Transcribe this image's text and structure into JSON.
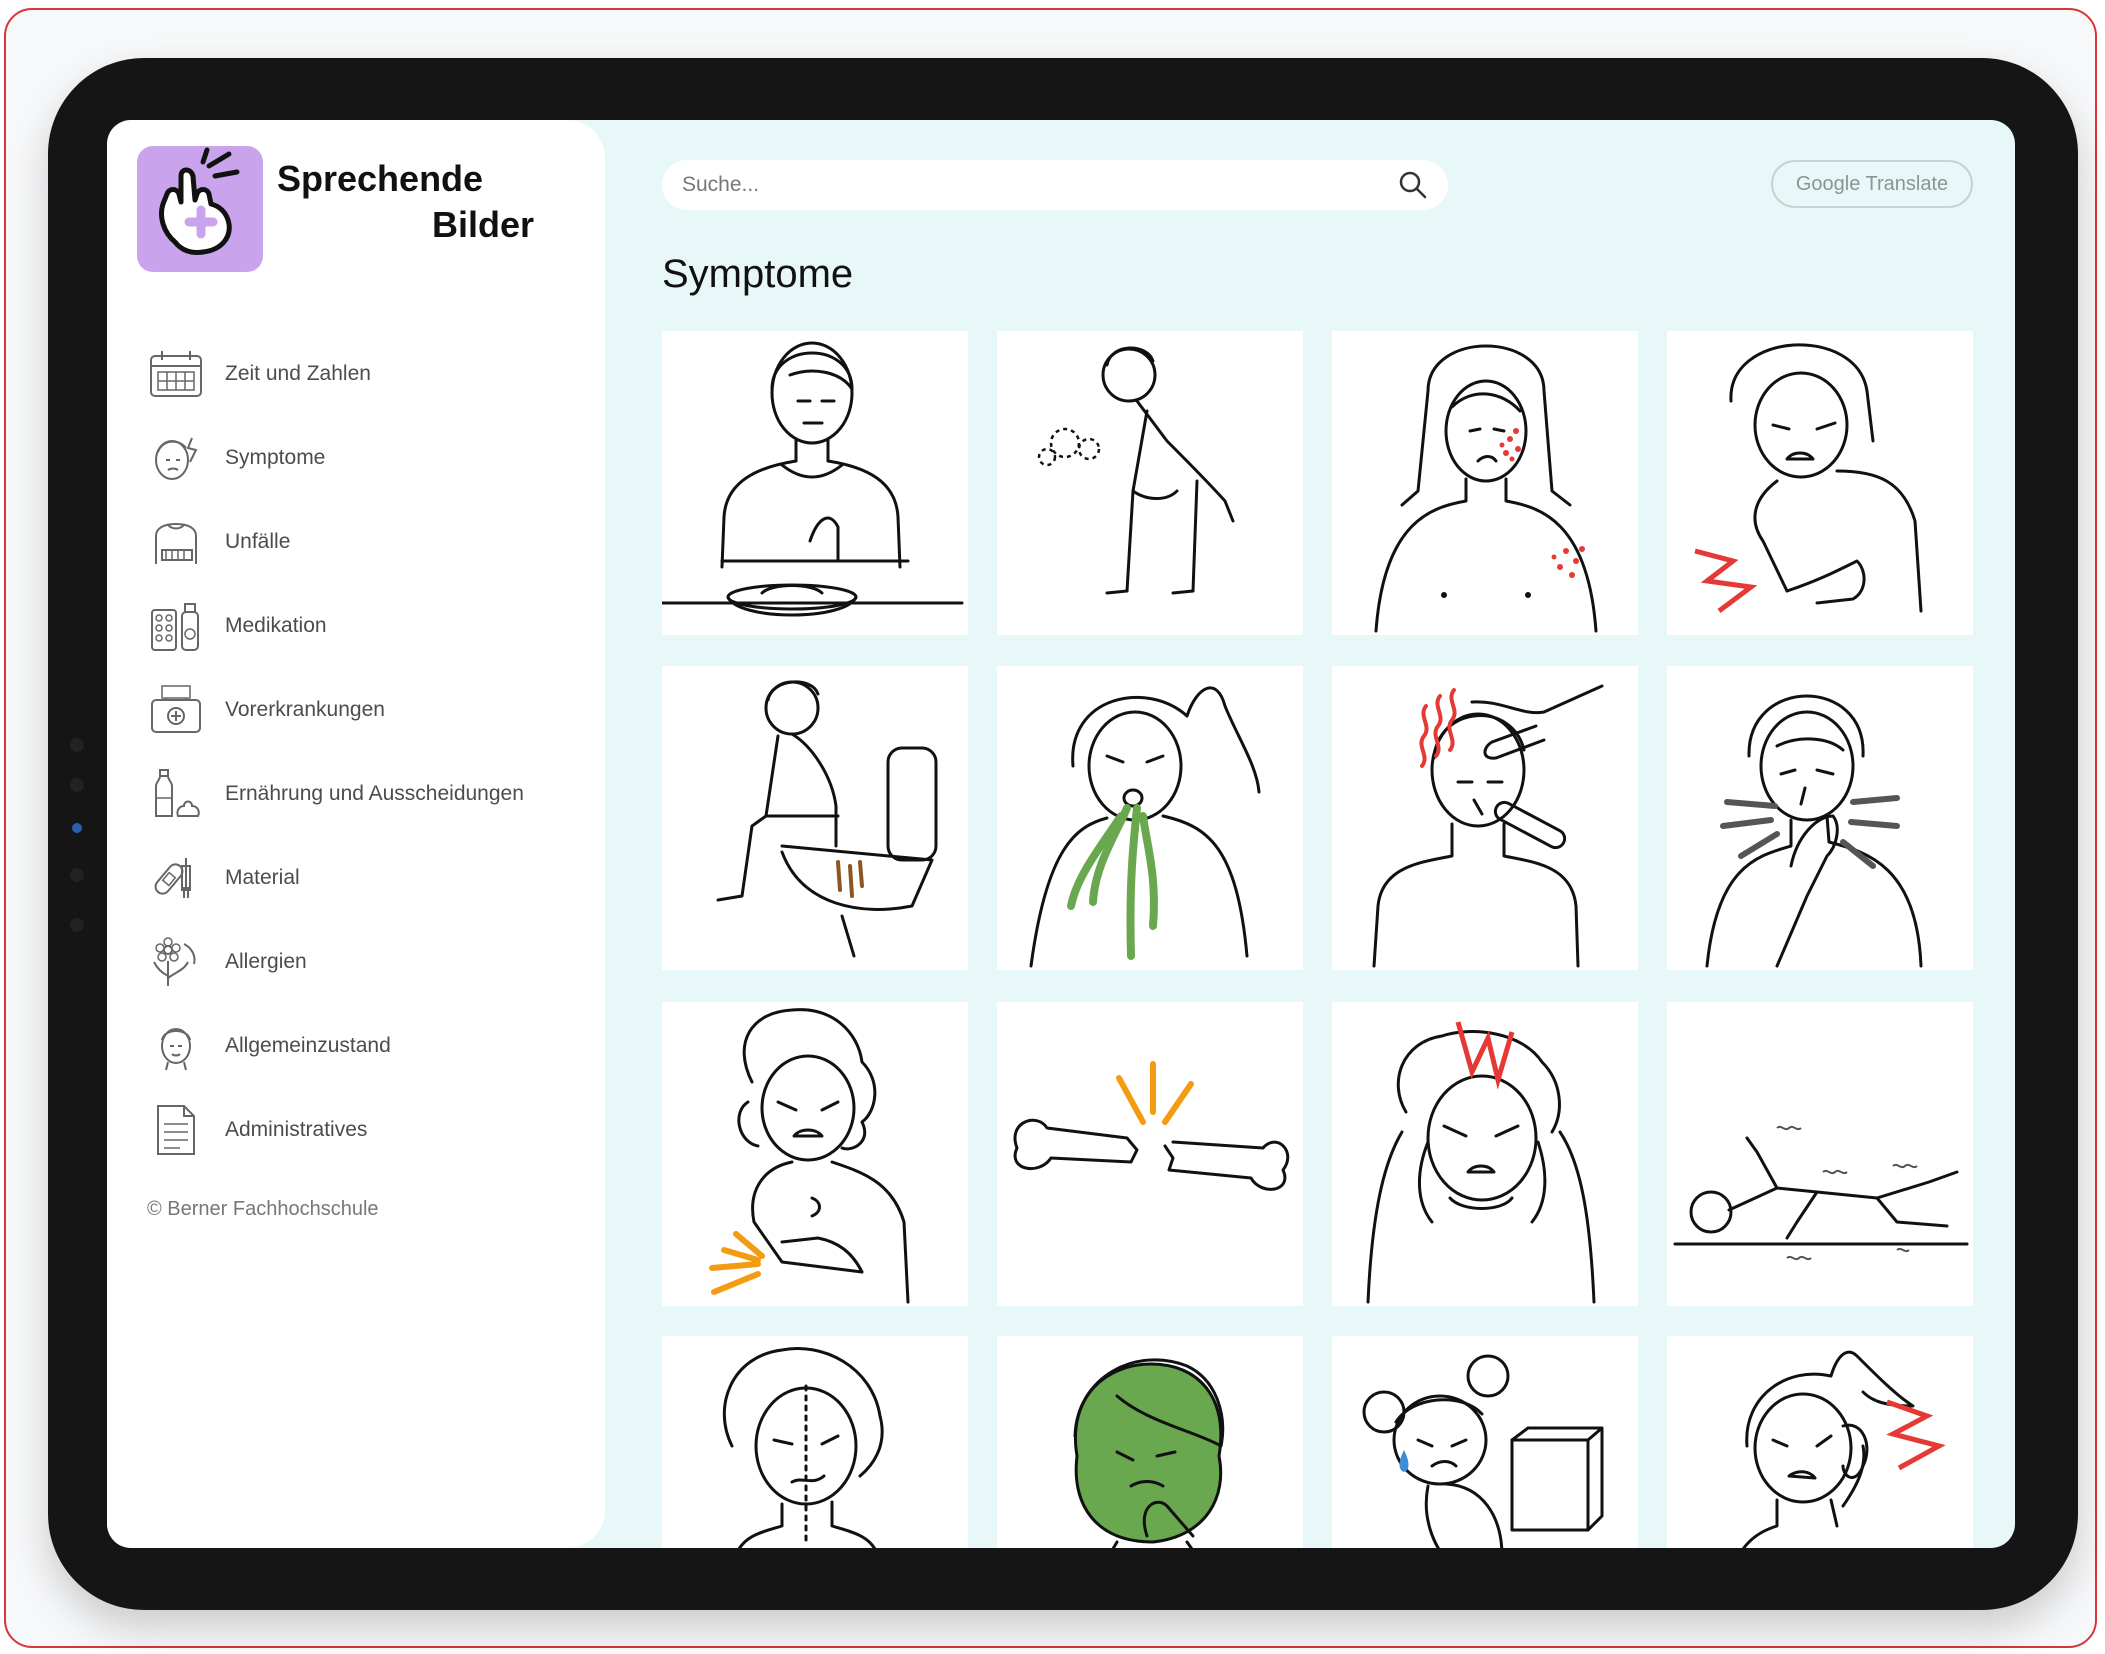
{
  "brand": {
    "line1": "Sprechende",
    "line2": "Bilder"
  },
  "search": {
    "placeholder": "Suche..."
  },
  "header": {
    "translate_label": "Google Translate"
  },
  "page": {
    "title": "Symptome"
  },
  "sidebar": {
    "items": [
      {
        "label": "Zeit und Zahlen",
        "icon": "calendar-icon"
      },
      {
        "label": "Symptome",
        "icon": "sick-face-icon"
      },
      {
        "label": "Unfälle",
        "icon": "arm-sling-icon"
      },
      {
        "label": "Medikation",
        "icon": "pills-icon"
      },
      {
        "label": "Vorerkrankungen",
        "icon": "medical-case-icon"
      },
      {
        "label": "Ernährung und Ausscheidungen",
        "icon": "bottle-icon"
      },
      {
        "label": "Material",
        "icon": "bandage-syringe-icon"
      },
      {
        "label": "Allergien",
        "icon": "flower-icon"
      },
      {
        "label": "Allgemeinzustand",
        "icon": "person-face-icon"
      },
      {
        "label": "Administratives",
        "icon": "document-icon"
      }
    ],
    "copyright": "© Berner Fachhochschule"
  },
  "colors": {
    "accent": "#c9a4ec",
    "background": "#e8f8f8",
    "symptom_red": "#e53935",
    "symptom_orange": "#f39c12",
    "symptom_green": "#6aa84f"
  },
  "cards": [
    "loss-of-appetite-icon",
    "breathing-difficulty-icon",
    "skin-rash-icon",
    "abdominal-pain-icon",
    "diarrhea-icon",
    "vomiting-icon",
    "fever-icon",
    "cough-icon",
    "arm-pain-icon",
    "broken-bone-icon",
    "headache-icon",
    "seizure-icon",
    "facial-paralysis-icon",
    "nausea-icon",
    "crying-child-icon",
    "earache-icon"
  ]
}
